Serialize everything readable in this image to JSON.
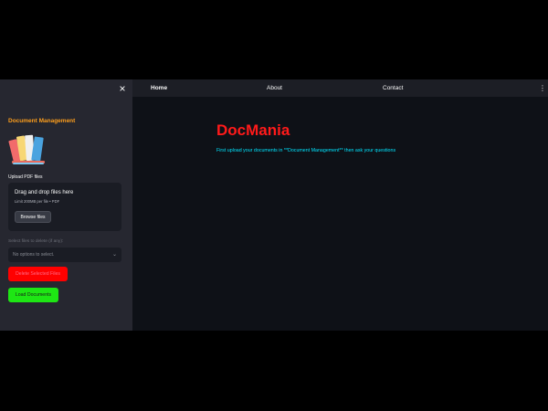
{
  "sidebar": {
    "close_icon": "close-icon",
    "close_glyph": "×",
    "title": "Document Management",
    "logo_icon": "books-icon",
    "upload_label": "Upload PDF files",
    "dropzone": {
      "title": "Drag and drop files here",
      "limit": "Limit 200MB per file • PDF",
      "browse_label": "Browse files"
    },
    "select": {
      "label": "Select files to delete (if any):",
      "placeholder": "No options to select.",
      "chevron_glyph": "⌄"
    },
    "delete_button": "Delete Selected Files",
    "load_button": "Load Documents"
  },
  "nav": {
    "items": [
      "Home",
      "About",
      "Contact"
    ],
    "menu_glyph": "⋮"
  },
  "main": {
    "title": "DocMania",
    "description": "First upload your documents in **Document Management** then ask your questions"
  },
  "colors": {
    "title_accent": "#ff1a1a",
    "sidebar_title": "#ff9f1c",
    "description": "#00e5ff",
    "delete_button_bg": "#ff0000",
    "load_button_bg": "#1ee614"
  }
}
